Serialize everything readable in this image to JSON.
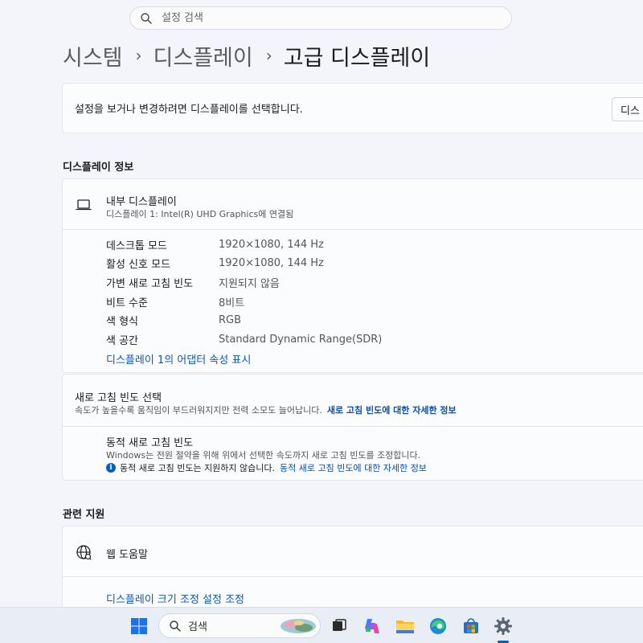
{
  "search": {
    "placeholder": "설정 검색"
  },
  "breadcrumb": {
    "level1": "시스템",
    "level2": "디스플레이",
    "current": "고급 디스플레이",
    "separator": "›"
  },
  "select_display": {
    "description": "설정을 보거나 변경하려면 디스플레이를 선택합니다.",
    "button_label": "디스"
  },
  "display_info": {
    "section_title": "디스플레이 정보",
    "display_name": "내부 디스플레이",
    "display_sub": "디스플레이 1: Intel(R) UHD Graphics에 연결됨",
    "properties": [
      {
        "label": "데스크톱 모드",
        "value": "1920×1080, 144 Hz"
      },
      {
        "label": "활성 신호 모드",
        "value": "1920×1080, 144 Hz"
      },
      {
        "label": "가변 새로 고침 빈도",
        "value": "지원되지 않음"
      },
      {
        "label": "비트 수준",
        "value": "8비트"
      },
      {
        "label": "색 형식",
        "value": "RGB"
      },
      {
        "label": "색 공간",
        "value": "Standard Dynamic Range(SDR)"
      }
    ],
    "adapter_link": "디스플레이 1의 어댑터 속성 표시"
  },
  "refresh_rate": {
    "title": "새로 고침 빈도 선택",
    "description": "속도가 높을수록 움직임이 부드러워지지만 전력 소모도 늘어납니다.",
    "more_info_link": "새로 고침 빈도에 대한 자세한 정보",
    "dynamic_title": "동적 새로 고침 빈도",
    "dynamic_description": "Windows는 전원 절약을 위해 위에서 선택한 속도까지 새로 고침 빈도를 조정합니다.",
    "dynamic_note": "동적 새로 고침 빈도는 지원하지 않습니다.",
    "dynamic_link": "동적 새로 고침 빈도에 대한 자세한 정보"
  },
  "related_support": {
    "section_title": "관련 지원",
    "web_help": "웹 도움말",
    "scaling_link": "디스플레이 크기 조정 설정 조정"
  },
  "taskbar": {
    "search_label": "검색",
    "icons": [
      "windows-start-icon",
      "task-view-icon",
      "copilot-icon",
      "file-explorer-icon",
      "edge-icon",
      "store-icon",
      "settings-icon"
    ],
    "accent": "#0a5ccc"
  },
  "colors": {
    "background": "#f3f5fa",
    "card": "#fbfcfe",
    "link": "#0b57b5"
  }
}
